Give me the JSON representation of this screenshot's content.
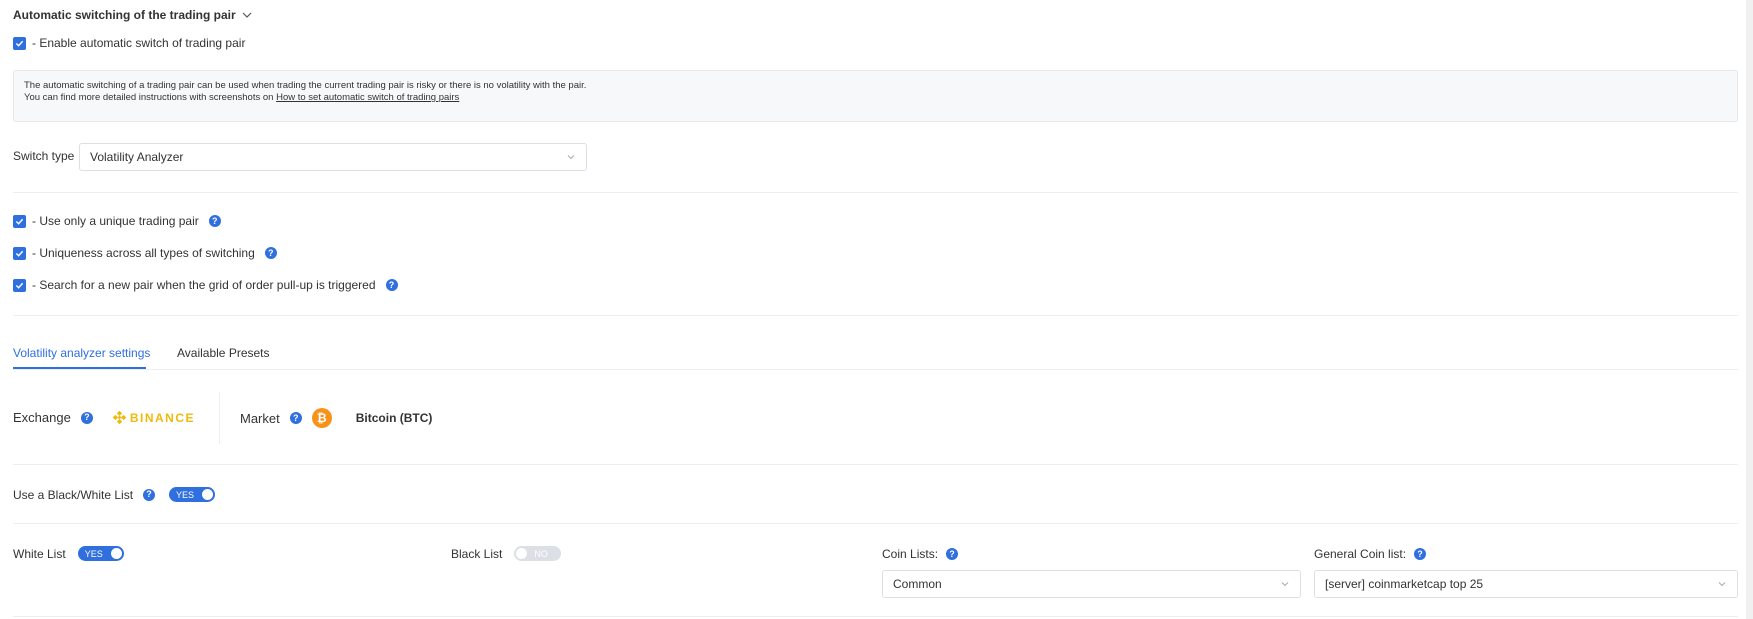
{
  "section": {
    "title": "Automatic switching of the trading pair"
  },
  "enable_switch": {
    "label": "- Enable automatic switch of trading pair",
    "checked": true
  },
  "info": {
    "line1": "The automatic switching of a trading pair can be used when trading the current trading pair is risky or there is no volatility with the pair.",
    "line2_prefix": "You can find more detailed instructions with screenshots on ",
    "link_text": "How to set automatic switch of trading pairs"
  },
  "switch_type": {
    "label": "Switch type",
    "value": "Volatility Analyzer"
  },
  "options": [
    {
      "label": "- Use only a unique trading pair",
      "checked": true
    },
    {
      "label": "- Uniqueness across all types of switching",
      "checked": true
    },
    {
      "label": "- Search for a new pair when the grid of order pull-up is triggered",
      "checked": true
    }
  ],
  "tabs": [
    {
      "label": "Volatility analyzer settings",
      "active": true
    },
    {
      "label": "Available Presets",
      "active": false
    }
  ],
  "exchange": {
    "label": "Exchange",
    "logo_text": "BINANCE"
  },
  "market": {
    "label": "Market",
    "coin_symbol": "₿",
    "value": "Bitcoin (BTC)"
  },
  "bw_list": {
    "label": "Use a Black/White List",
    "toggle": "YES"
  },
  "white_list": {
    "label": "White List",
    "toggle": "YES"
  },
  "black_list": {
    "label": "Black List",
    "toggle": "NO"
  },
  "coin_lists": {
    "label": "Coin Lists:",
    "value": "Common"
  },
  "general_coin_list": {
    "label": "General Coin list:",
    "value": "[server] coinmarketcap top 25"
  },
  "help_glyph": "?",
  "colors": {
    "accent": "#2f6fde",
    "binance": "#f0b90b",
    "btc": "#f7931a"
  }
}
